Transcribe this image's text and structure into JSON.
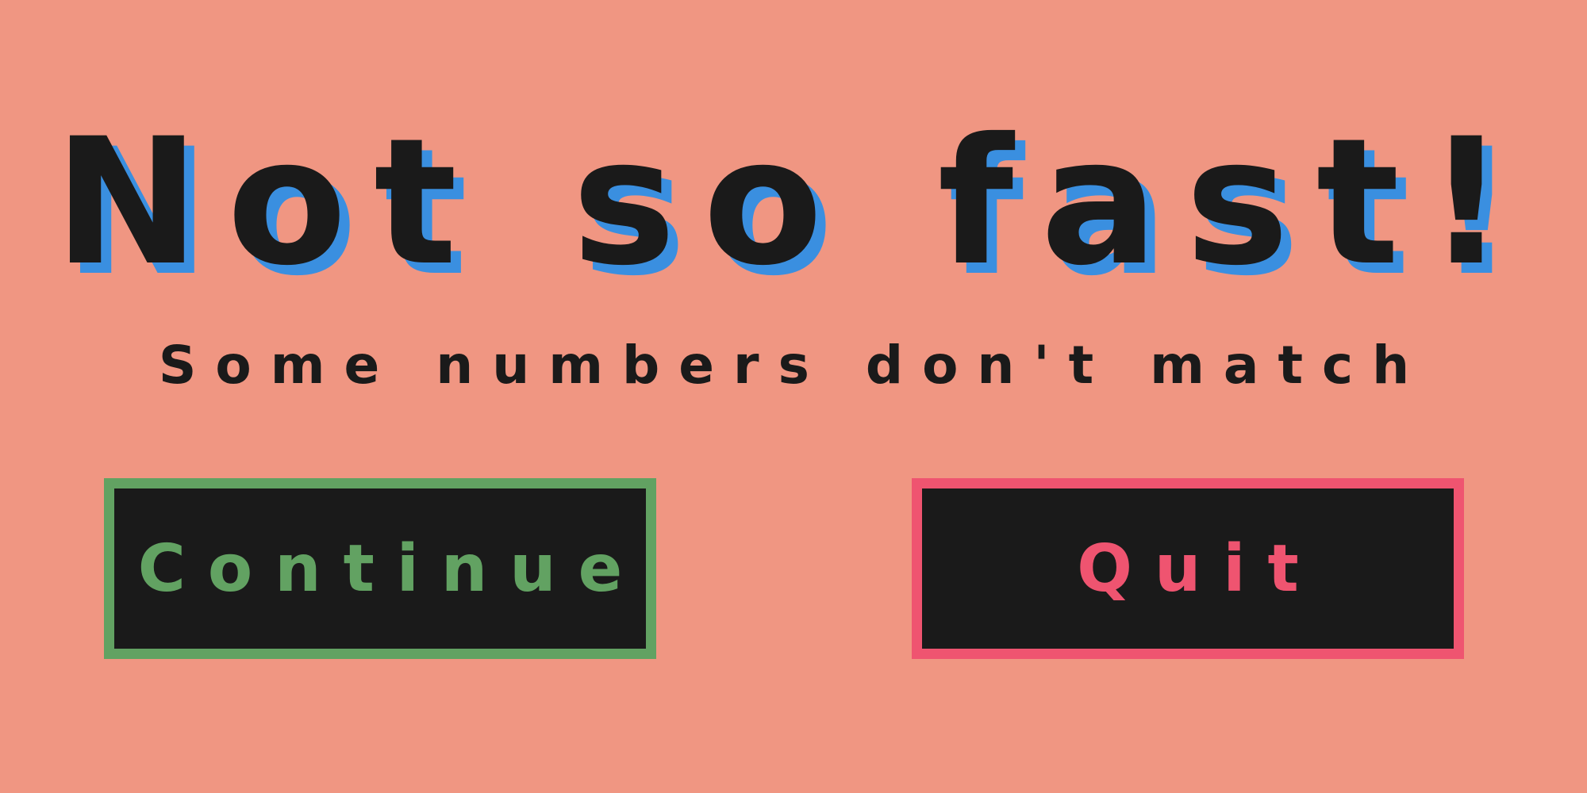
{
  "title": "Not so fast!",
  "subtitle": "Some numbers don't match",
  "buttons": {
    "continue_label": "Continue",
    "quit_label": "Quit"
  },
  "colors": {
    "background": "#f09682",
    "text": "#1a1a1a",
    "title_shadow": "#3a8fe0",
    "continue_accent": "#62a262",
    "quit_accent": "#ef5470",
    "button_fill": "#1a1a1a"
  }
}
